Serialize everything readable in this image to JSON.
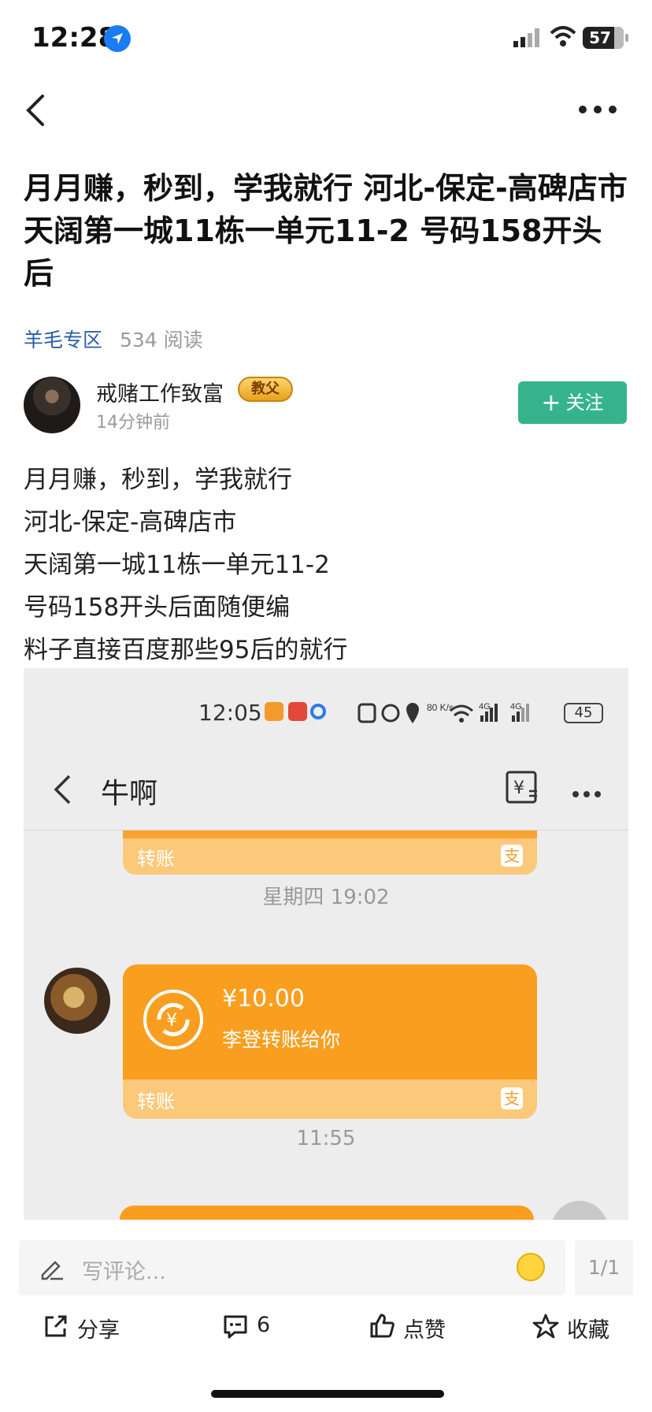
{
  "status_bar": {
    "time": "12:28",
    "battery": "57"
  },
  "post": {
    "title": "月月赚，秒到，学我就行 河北-保定-高碑店市 天阔第一城11栋一单元11-2 号码158开头后",
    "category": "羊毛专区",
    "reads": "534 阅读",
    "author": {
      "name": "戒赌工作致富",
      "badge": "教父",
      "time": "14分钟前"
    },
    "follow_label": "关注",
    "follow_icon": "plus-icon",
    "body_lines": [
      "月月赚，秒到，学我就行",
      "河北-保定-高碑店市",
      "天阔第一城11栋一单元11-2",
      "号码158开头后面随便编",
      "料子直接百度那些95后的就行"
    ]
  },
  "embedded_chat": {
    "status_time": "12:05",
    "net_speed": "80 K/s",
    "net_labels": [
      "4G",
      "4G"
    ],
    "battery": "45",
    "chat_title": "牛啊",
    "transfer_label": "转账",
    "pay_icon_char": "支",
    "date_separator": "星期四 19:02",
    "amount": "¥10.00",
    "transfer_desc": "李登转账给你",
    "time_separator": "11:55"
  },
  "bottom_bar": {
    "comment_placeholder": "写评论...",
    "page_indicator": "1/1",
    "actions": [
      {
        "label": "分享",
        "icon": "share-icon"
      },
      {
        "label": "6",
        "icon": "comment-icon"
      },
      {
        "label": "点赞",
        "icon": "like-icon"
      },
      {
        "label": "收藏",
        "icon": "star-icon"
      }
    ]
  },
  "colors": {
    "follow": "#35b48c",
    "category": "#2b5fa6",
    "transfer_orange": "#fa9e20"
  }
}
